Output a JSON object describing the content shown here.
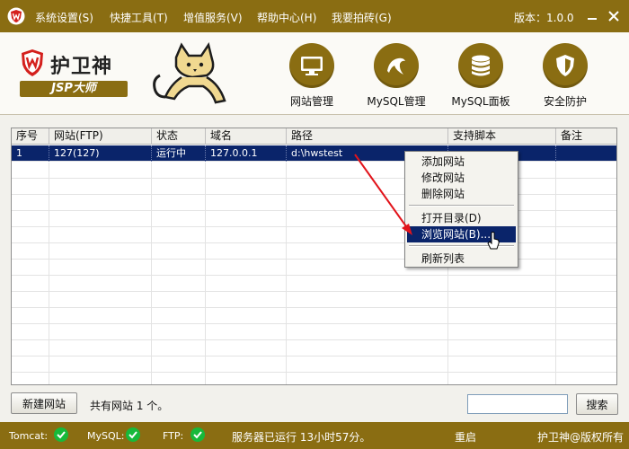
{
  "menubar": {
    "items": [
      "系统设置(S)",
      "快捷工具(T)",
      "增值服务(V)",
      "帮助中心(H)",
      "我要拍砖(G)"
    ],
    "version": "版本：1.0.0"
  },
  "header": {
    "brand_name": "护卫神",
    "brand_badge": "JSP大师",
    "tools": [
      {
        "label": "网站管理",
        "icon": "monitor-icon"
      },
      {
        "label": "MySQL管理",
        "icon": "dolphin-icon"
      },
      {
        "label": "MySQL面板",
        "icon": "database-icon"
      },
      {
        "label": "安全防护",
        "icon": "shield-icon"
      }
    ]
  },
  "table": {
    "columns": [
      "序号",
      "网站(FTP)",
      "状态",
      "域名",
      "路径",
      "支持脚本",
      "备注"
    ],
    "rows": [
      {
        "index": "1",
        "site": "127(127)",
        "status": "运行中",
        "domain": "127.0.0.1",
        "path": "d:\\hwstest",
        "script": "",
        "note": ""
      }
    ]
  },
  "context_menu": {
    "items": [
      "添加网站",
      "修改网站",
      "删除网站",
      "打开目录(D)",
      "浏览网站(B)...",
      "刷新列表"
    ],
    "highlighted": "浏览网站(B)..."
  },
  "bottom": {
    "new_site_label": "新建网站",
    "site_count": "共有网站 1 个。",
    "search_placeholder": "",
    "search_value": "",
    "search_label": "搜索"
  },
  "status_bar": {
    "tomcat_label": "Tomcat:",
    "mysql_label": "MySQL:",
    "ftp_label": "FTP:",
    "uptime": "服务器已运行 13小时57分。",
    "restart_label": "重启",
    "copyright": "护卫神@版权所有"
  },
  "colors": {
    "accent": "#8a6d12",
    "selection": "#0a246a",
    "ok": "#17b93a",
    "arrow": "#e2141b"
  }
}
